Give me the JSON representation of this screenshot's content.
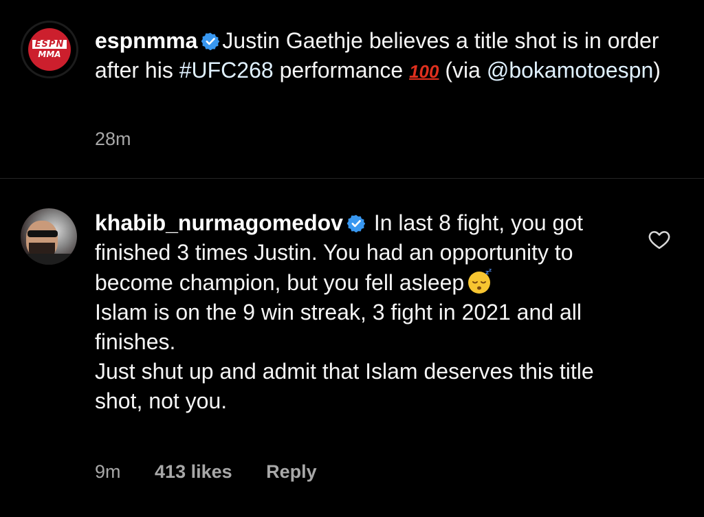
{
  "post": {
    "username": "espnmma",
    "avatar_text": {
      "top": "ESPN",
      "bottom": "MMA"
    },
    "caption_start": "Justin Gaethje believes a title shot is in order after his ",
    "hashtag": "#UFC268",
    "caption_mid": " performance ",
    "emoji_hundred": "100",
    "caption_via": " (via ",
    "mention": "@bokamotoespn",
    "caption_end": ")",
    "timestamp": "28m"
  },
  "comment": {
    "username": "khabib_nurmagomedov",
    "text_part1": " In last 8 fight, you got finished 3 times Justin.  You had an opportunity to become champion, but you fell asleep",
    "line2": "Islam is on the 9 win streak, 3 fight in 2021 and all finishes.",
    "line3": "Just shut up and admit that Islam deserves this title shot, not you.",
    "timestamp": "9m",
    "likes": "413 likes",
    "reply_label": "Reply"
  },
  "icons": {
    "verified": "verified-badge-icon",
    "heart": "heart-outline-icon",
    "sleep": "sleeping-face-emoji"
  },
  "colors": {
    "background": "#000000",
    "verified_blue": "#3897f0",
    "meta_gray": "#a8a8a8",
    "espn_red": "#cc1f2d"
  }
}
